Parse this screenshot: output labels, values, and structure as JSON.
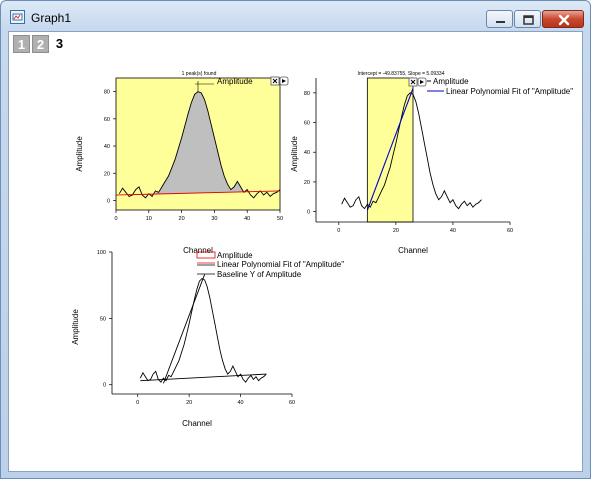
{
  "window": {
    "title": "Graph1",
    "controls": {
      "minimize": "minimize",
      "maximize": "maximize",
      "close": "close"
    }
  },
  "layer_tabs": [
    "1",
    "2",
    "3"
  ],
  "active_layer": "3",
  "colors": {
    "plot_fill": "#ffff99",
    "area_fill": "#bfbfbf",
    "baseline": "#e00000",
    "fit_line": "#0000cc",
    "curve": "#000000"
  },
  "panels": {
    "top_left": {
      "header": "1 peak(s) found",
      "legend": [
        "Amplitude"
      ],
      "xlabel": "Channel",
      "ylabel": "Amplitude"
    },
    "top_right": {
      "header": "Intercept = -49.83755, Slope = 5.09334",
      "legend": [
        "Amplitude",
        "Linear Polynomial Fit of \"Amplitude\""
      ],
      "xlabel": "Channel",
      "ylabel": "Amplitude"
    },
    "bottom": {
      "legend": [
        "Amplitude",
        "Linear Polynomial Fit of \"Amplitude\"",
        "Baseline Y of Amplitude"
      ],
      "xlabel": "Channel",
      "ylabel": "Amplitude"
    }
  },
  "chart_data": [
    {
      "type": "area",
      "xlabel": "Channel",
      "ylabel": "Amplitude",
      "xlim": [
        0,
        50
      ],
      "ylim": [
        -7,
        90
      ],
      "x_ticks": [
        "0",
        "10",
        "20",
        "30",
        "40",
        "50"
      ],
      "y_ticks": [
        "0",
        "20",
        "40",
        "60",
        "80"
      ],
      "series": [
        {
          "name": "Amplitude",
          "x": [
            1,
            2,
            3,
            4,
            5,
            6,
            7,
            8,
            9,
            10,
            11,
            12,
            13,
            14,
            15,
            16,
            17,
            18,
            19,
            20,
            21,
            22,
            23,
            24,
            25,
            26,
            27,
            28,
            29,
            30,
            31,
            32,
            33,
            34,
            35,
            36,
            37,
            38,
            39,
            40,
            41,
            42,
            43,
            44,
            45,
            46,
            47,
            48,
            49,
            50
          ],
          "y": [
            5,
            9,
            6,
            3,
            4,
            8,
            10,
            4,
            2,
            5,
            3,
            7,
            6,
            10,
            14,
            18,
            24,
            30,
            38,
            46,
            55,
            64,
            72,
            78,
            80,
            79,
            74,
            66,
            56,
            46,
            36,
            26,
            18,
            12,
            8,
            10,
            14,
            10,
            6,
            8,
            4,
            2,
            5,
            7,
            4,
            6,
            3,
            5,
            6,
            8
          ]
        }
      ],
      "baseline": {
        "x": [
          0,
          50
        ],
        "y": [
          4,
          7
        ]
      },
      "marker": {
        "label": "Amplitude",
        "x": 25,
        "y": 80
      }
    },
    {
      "type": "line",
      "xlabel": "Channel",
      "ylabel": "Amplitude",
      "xlim": [
        -8,
        60
      ],
      "ylim": [
        -7,
        90
      ],
      "x_ticks": [
        "0",
        "20",
        "40",
        "60"
      ],
      "y_ticks": [
        "0",
        "20",
        "40",
        "60",
        "80"
      ],
      "series": [
        {
          "name": "Amplitude",
          "x": [
            1,
            2,
            3,
            4,
            5,
            6,
            7,
            8,
            9,
            10,
            11,
            12,
            13,
            14,
            15,
            16,
            17,
            18,
            19,
            20,
            21,
            22,
            23,
            24,
            25,
            26,
            27,
            28,
            29,
            30,
            31,
            32,
            33,
            34,
            35,
            36,
            37,
            38,
            39,
            40,
            41,
            42,
            43,
            44,
            45,
            46,
            47,
            48,
            49,
            50
          ],
          "y": [
            5,
            9,
            6,
            3,
            4,
            8,
            10,
            4,
            2,
            5,
            3,
            7,
            6,
            10,
            14,
            18,
            24,
            30,
            38,
            46,
            55,
            64,
            72,
            78,
            80,
            79,
            74,
            66,
            56,
            46,
            36,
            26,
            18,
            12,
            8,
            10,
            14,
            10,
            6,
            8,
            4,
            2,
            5,
            7,
            4,
            6,
            3,
            5,
            6,
            8
          ]
        },
        {
          "name": "Linear Polynomial Fit of \"Amplitude\"",
          "x": [
            10,
            26
          ],
          "y": [
            1,
            83
          ]
        }
      ],
      "highlight_range": [
        10,
        26
      ]
    },
    {
      "type": "line",
      "xlabel": "Channel",
      "ylabel": "Amplitude",
      "xlim": [
        -10,
        60
      ],
      "ylim": [
        -7,
        100
      ],
      "x_ticks": [
        "0",
        "20",
        "40",
        "60"
      ],
      "y_ticks": [
        "0",
        "50",
        "100"
      ],
      "series": [
        {
          "name": "Amplitude",
          "x": [
            1,
            2,
            3,
            4,
            5,
            6,
            7,
            8,
            9,
            10,
            11,
            12,
            13,
            14,
            15,
            16,
            17,
            18,
            19,
            20,
            21,
            22,
            23,
            24,
            25,
            26,
            27,
            28,
            29,
            30,
            31,
            32,
            33,
            34,
            35,
            36,
            37,
            38,
            39,
            40,
            41,
            42,
            43,
            44,
            45,
            46,
            47,
            48,
            49,
            50
          ],
          "y": [
            5,
            9,
            6,
            3,
            4,
            8,
            10,
            4,
            2,
            5,
            3,
            7,
            6,
            10,
            14,
            18,
            24,
            30,
            38,
            46,
            55,
            64,
            72,
            78,
            80,
            79,
            74,
            66,
            56,
            46,
            36,
            26,
            18,
            12,
            8,
            10,
            14,
            10,
            6,
            8,
            4,
            2,
            5,
            7,
            4,
            6,
            3,
            5,
            6,
            8
          ]
        },
        {
          "name": "Linear Polynomial Fit of \"Amplitude\"",
          "x": [
            10,
            26
          ],
          "y": [
            1,
            83
          ]
        },
        {
          "name": "Baseline Y of Amplitude",
          "x": [
            1,
            50
          ],
          "y": [
            3,
            8
          ]
        }
      ]
    }
  ]
}
